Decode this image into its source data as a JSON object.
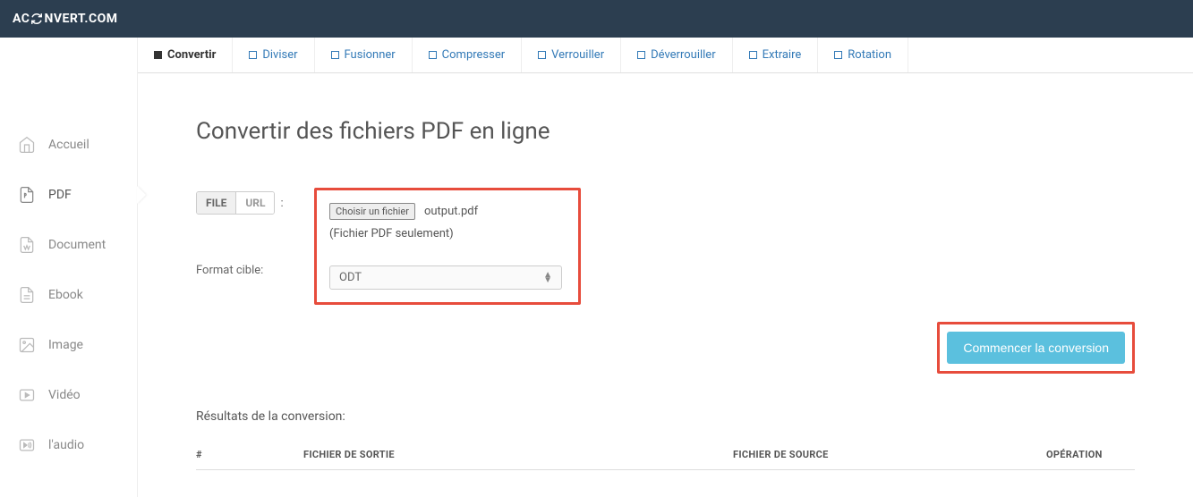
{
  "brand": {
    "left": "AC",
    "right": "NVERT.COM"
  },
  "sidebar": {
    "items": [
      {
        "label": "Accueil"
      },
      {
        "label": "PDF"
      },
      {
        "label": "Document"
      },
      {
        "label": "Ebook"
      },
      {
        "label": "Image"
      },
      {
        "label": "Vidéo"
      },
      {
        "label": "l'audio"
      }
    ]
  },
  "tabs": [
    {
      "label": "Convertir"
    },
    {
      "label": "Diviser"
    },
    {
      "label": "Fusionner"
    },
    {
      "label": "Compresser"
    },
    {
      "label": "Verrouiller"
    },
    {
      "label": "Déverrouiller"
    },
    {
      "label": "Extraire"
    },
    {
      "label": "Rotation"
    }
  ],
  "page": {
    "title": "Convertir des fichiers PDF en ligne",
    "toggle_file": "FILE",
    "toggle_url": "URL",
    "choose_file": "Choisir un fichier",
    "selected_file": "output.pdf",
    "file_hint": "(Fichier PDF seulement)",
    "format_label": "Format cible:",
    "format_value": "ODT",
    "convert_button": "Commencer la conversion",
    "results_label": "Résultats de la conversion:",
    "col_num": "#",
    "col_out": "FICHIER DE SORTIE",
    "col_src": "FICHIER DE SOURCE",
    "col_op": "OPÉRATION"
  }
}
